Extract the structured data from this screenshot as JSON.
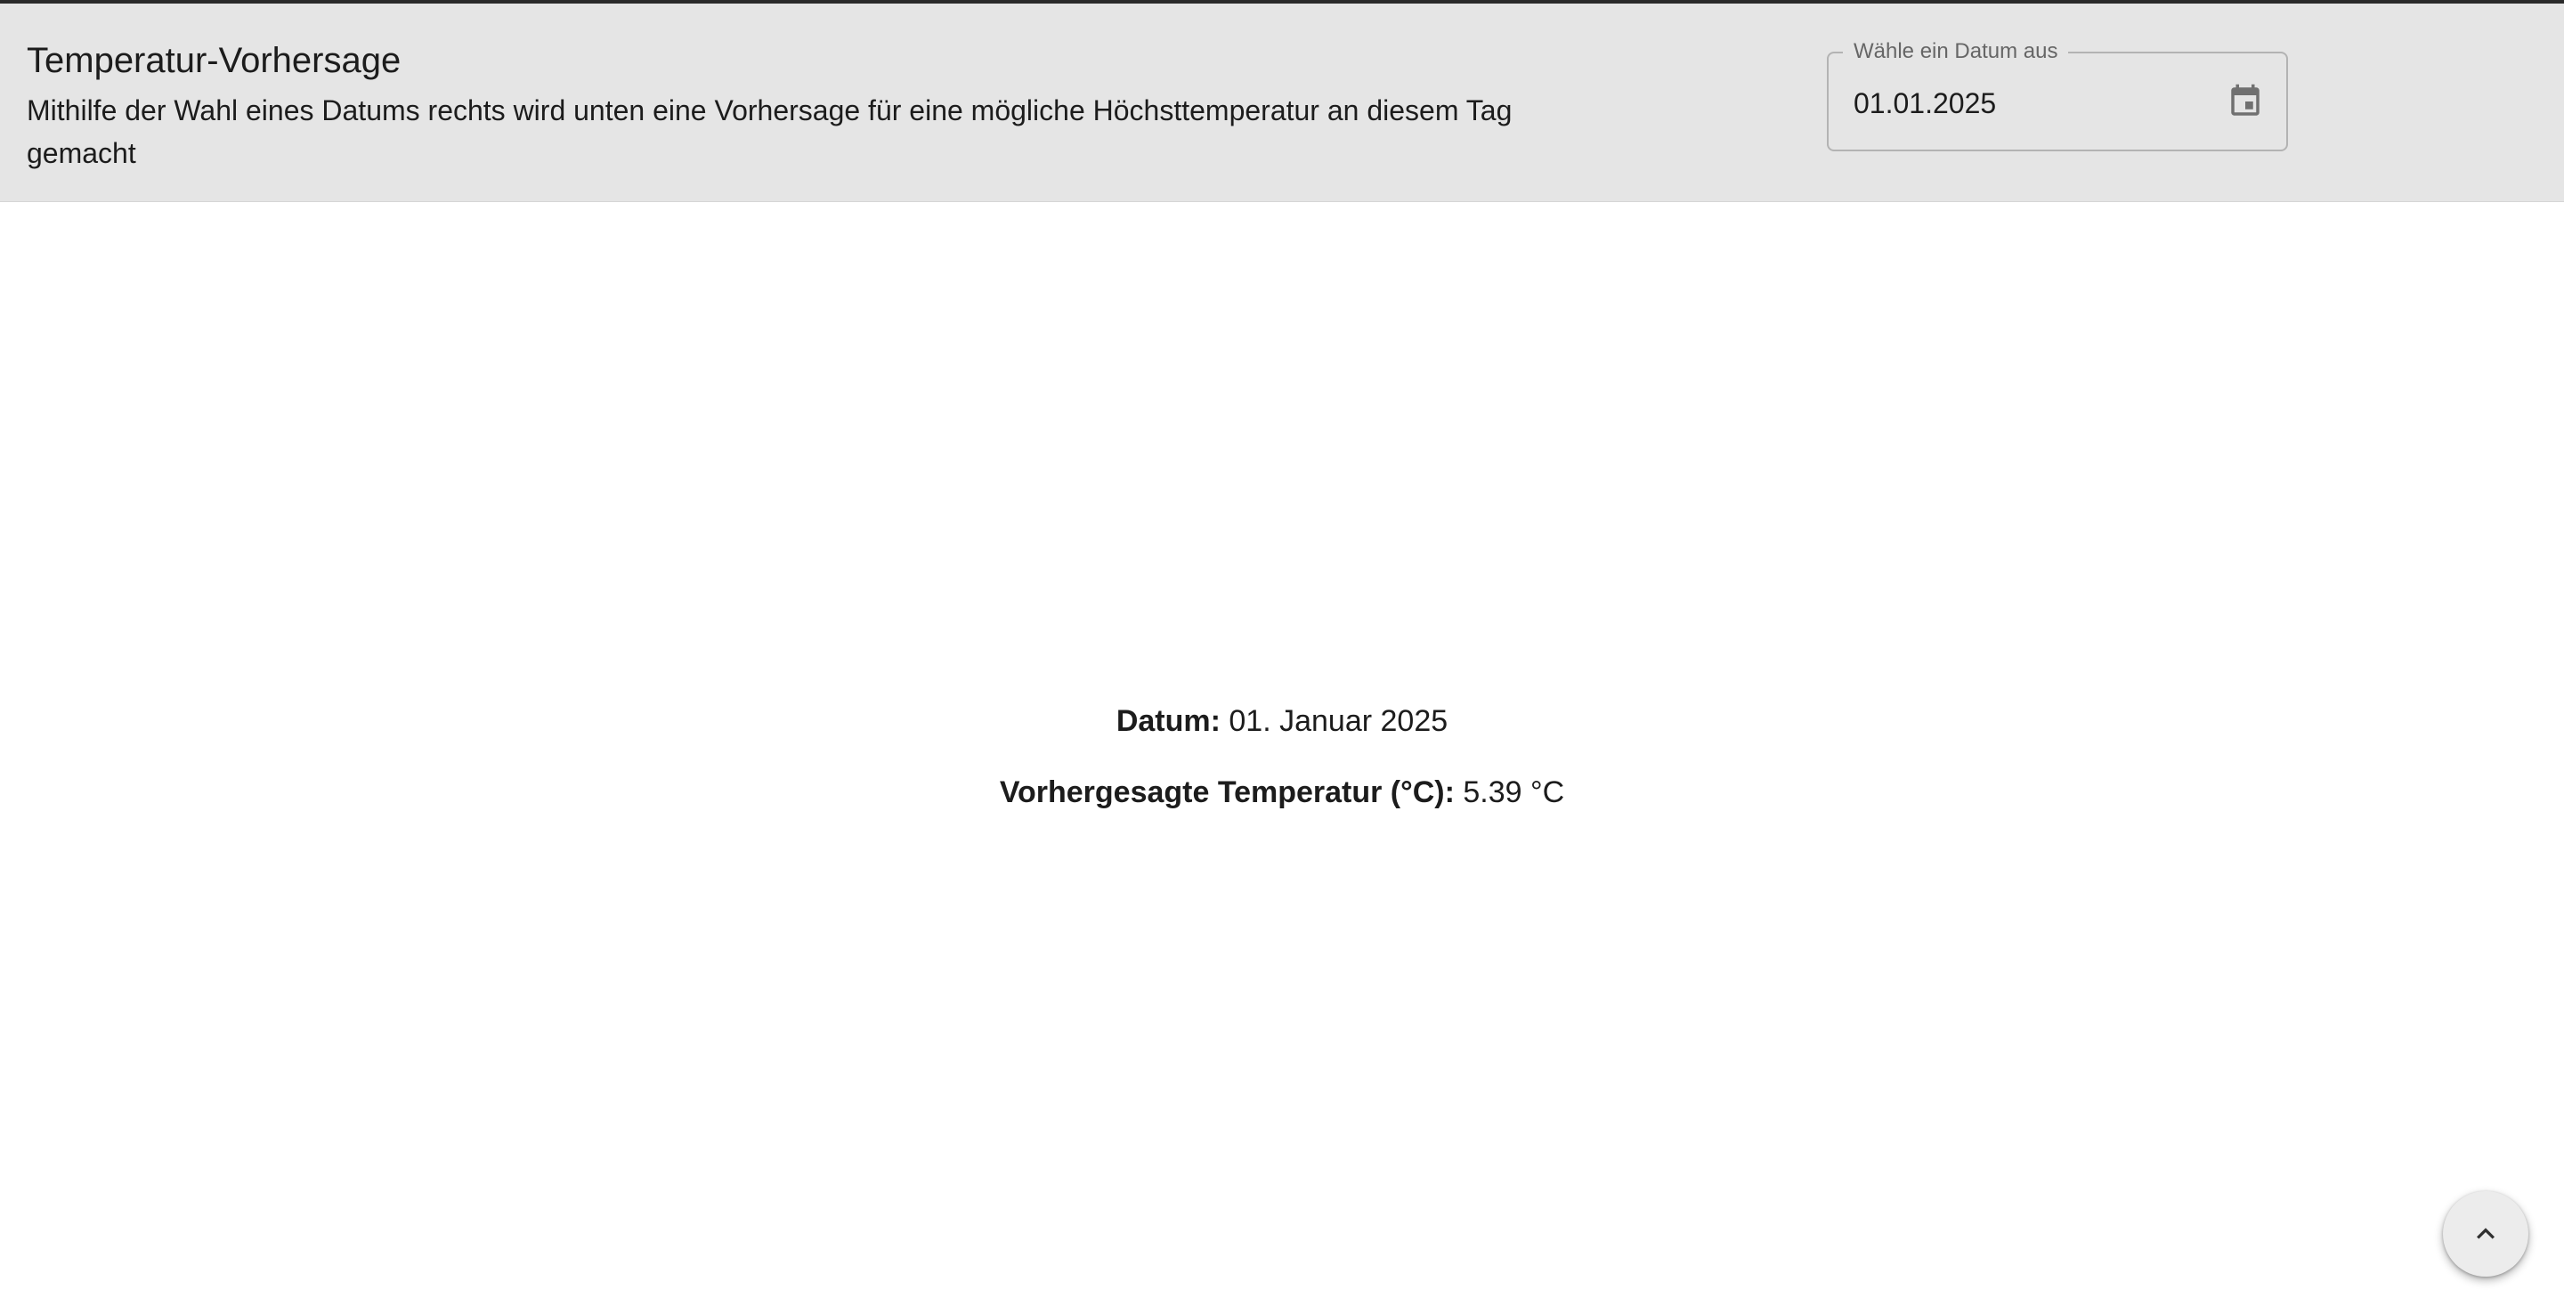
{
  "header": {
    "title": "Temperatur-Vorhersage",
    "subtitle": "Mithilfe der Wahl eines Datums rechts wird unten eine Vorhersage für eine mögliche Höchsttemperatur an diesem Tag gemacht"
  },
  "date_picker": {
    "label": "Wähle ein Datum aus",
    "value": "01.01.2025",
    "icon": "calendar-icon"
  },
  "result": {
    "date_label": "Datum:",
    "date_value": "01. Januar 2025",
    "temperature_label": "Vorhergesagte Temperatur (°C):",
    "temperature_value": "5.39 °C"
  },
  "scroll_top": {
    "icon": "chevron-up-icon"
  }
}
